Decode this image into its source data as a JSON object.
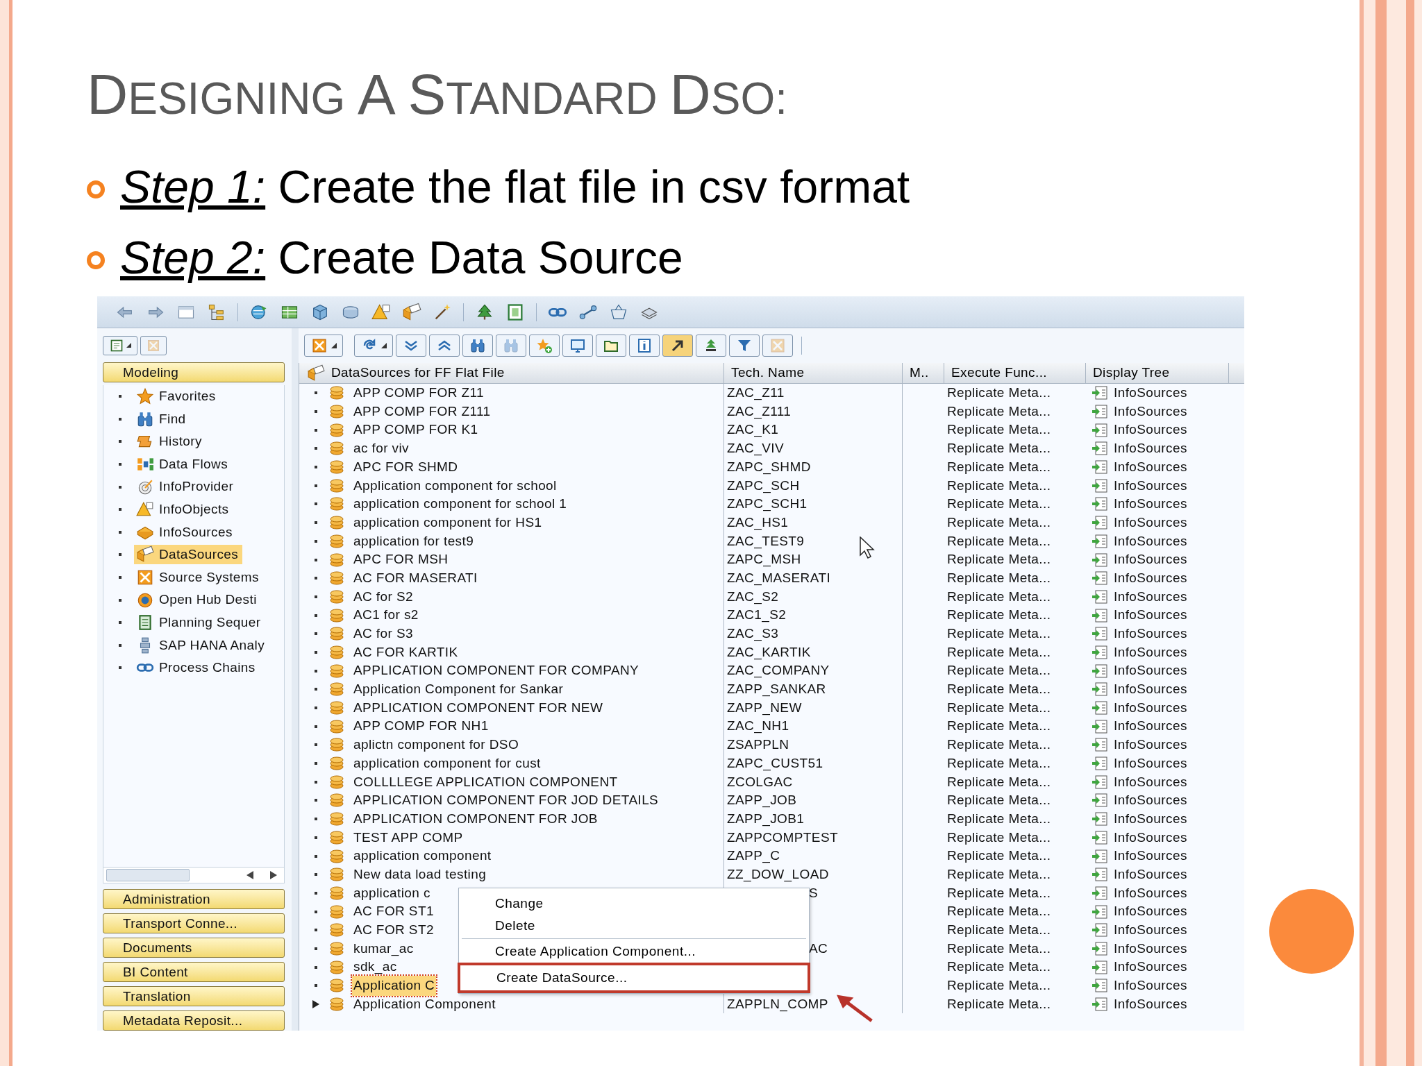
{
  "slide": {
    "title": "DESIGNING A STANDARD DSO:",
    "bullets": [
      {
        "step": "Step 1:",
        "text": "Create the flat file in csv format"
      },
      {
        "step": "Step 2:",
        "text": "Create Data Source"
      }
    ]
  },
  "sidebar": {
    "header": "Modeling",
    "items": [
      {
        "label": "Favorites",
        "selected": false
      },
      {
        "label": "Find",
        "selected": false
      },
      {
        "label": "History",
        "selected": false
      },
      {
        "label": "Data Flows",
        "selected": false
      },
      {
        "label": "InfoProvider",
        "selected": false
      },
      {
        "label": "InfoObjects",
        "selected": false
      },
      {
        "label": "InfoSources",
        "selected": false
      },
      {
        "label": "DataSources",
        "selected": true
      },
      {
        "label": "Source Systems",
        "selected": false
      },
      {
        "label": "Open Hub Desti",
        "selected": false
      },
      {
        "label": "Planning Sequer",
        "selected": false
      },
      {
        "label": "SAP HANA Analy",
        "selected": false
      },
      {
        "label": "Process Chains",
        "selected": false
      }
    ],
    "sections": [
      "Administration",
      "Transport Conne...",
      "Documents",
      "BI Content",
      "Translation",
      "Metadata Reposit..."
    ]
  },
  "table": {
    "columns": [
      "DataSources for FF Flat File",
      "Tech. Name",
      "M..",
      "Execute Func...",
      "Display Tree"
    ],
    "rows": [
      {
        "name": "APP COMP FOR Z11",
        "tech_name": "ZAC_Z11",
        "execute": "Replicate Meta...",
        "display": "InfoSources",
        "expandable": false,
        "selected": false
      },
      {
        "name": "APP COMP FOR Z111",
        "tech_name": "ZAC_Z111",
        "execute": "Replicate Meta...",
        "display": "InfoSources",
        "expandable": false,
        "selected": false
      },
      {
        "name": "APP COMP FOR K1",
        "tech_name": "ZAC_K1",
        "execute": "Replicate Meta...",
        "display": "InfoSources",
        "expandable": false,
        "selected": false
      },
      {
        "name": "ac for viv",
        "tech_name": "ZAC_VIV",
        "execute": "Replicate Meta...",
        "display": "InfoSources",
        "expandable": false,
        "selected": false
      },
      {
        "name": "APC FOR SHMD",
        "tech_name": "ZAPC_SHMD",
        "execute": "Replicate Meta...",
        "display": "InfoSources",
        "expandable": false,
        "selected": false
      },
      {
        "name": "Application component for school",
        "tech_name": "ZAPC_SCH",
        "execute": "Replicate Meta...",
        "display": "InfoSources",
        "expandable": false,
        "selected": false
      },
      {
        "name": "application component for school 1",
        "tech_name": "ZAPC_SCH1",
        "execute": "Replicate Meta...",
        "display": "InfoSources",
        "expandable": false,
        "selected": false
      },
      {
        "name": "application component for HS1",
        "tech_name": "ZAC_HS1",
        "execute": "Replicate Meta...",
        "display": "InfoSources",
        "expandable": false,
        "selected": false
      },
      {
        "name": "application for test9",
        "tech_name": "ZAC_TEST9",
        "execute": "Replicate Meta...",
        "display": "InfoSources",
        "expandable": false,
        "selected": false
      },
      {
        "name": "APC FOR MSH",
        "tech_name": "ZAPC_MSH",
        "execute": "Replicate Meta...",
        "display": "InfoSources",
        "expandable": false,
        "selected": false
      },
      {
        "name": "AC FOR MASERATI",
        "tech_name": "ZAC_MASERATI",
        "execute": "Replicate Meta...",
        "display": "InfoSources",
        "expandable": false,
        "selected": false
      },
      {
        "name": "AC for S2",
        "tech_name": "ZAC_S2",
        "execute": "Replicate Meta...",
        "display": "InfoSources",
        "expandable": false,
        "selected": false
      },
      {
        "name": "AC1 for s2",
        "tech_name": "ZAC1_S2",
        "execute": "Replicate Meta...",
        "display": "InfoSources",
        "expandable": false,
        "selected": false
      },
      {
        "name": "AC for S3",
        "tech_name": "ZAC_S3",
        "execute": "Replicate Meta...",
        "display": "InfoSources",
        "expandable": false,
        "selected": false
      },
      {
        "name": "AC FOR KARTIK",
        "tech_name": "ZAC_KARTIK",
        "execute": "Replicate Meta...",
        "display": "InfoSources",
        "expandable": false,
        "selected": false
      },
      {
        "name": "APPLICATION COMPONENT FOR COMPANY",
        "tech_name": "ZAC_COMPANY",
        "execute": "Replicate Meta...",
        "display": "InfoSources",
        "expandable": false,
        "selected": false
      },
      {
        "name": "Application Component for Sankar",
        "tech_name": "ZAPP_SANKAR",
        "execute": "Replicate Meta...",
        "display": "InfoSources",
        "expandable": false,
        "selected": false
      },
      {
        "name": "APPLICATION COMPONENT FOR NEW",
        "tech_name": "ZAPP_NEW",
        "execute": "Replicate Meta...",
        "display": "InfoSources",
        "expandable": false,
        "selected": false
      },
      {
        "name": "APP COMP FOR NH1",
        "tech_name": "ZAC_NH1",
        "execute": "Replicate Meta...",
        "display": "InfoSources",
        "expandable": false,
        "selected": false
      },
      {
        "name": "aplictn component for DSO",
        "tech_name": "ZSAPPLN",
        "execute": "Replicate Meta...",
        "display": "InfoSources",
        "expandable": false,
        "selected": false
      },
      {
        "name": "application component for cust",
        "tech_name": "ZAPC_CUST51",
        "execute": "Replicate Meta...",
        "display": "InfoSources",
        "expandable": false,
        "selected": false
      },
      {
        "name": "COLLLLEGE APPLICATION COMPONENT",
        "tech_name": "ZCOLGAC",
        "execute": "Replicate Meta...",
        "display": "InfoSources",
        "expandable": false,
        "selected": false
      },
      {
        "name": "APPLICATION COMPONENT FOR JOD DETAILS",
        "tech_name": "ZAPP_JOB",
        "execute": "Replicate Meta...",
        "display": "InfoSources",
        "expandable": false,
        "selected": false
      },
      {
        "name": "APPLICATION COMPONENT FOR JOB",
        "tech_name": "ZAPP_JOB1",
        "execute": "Replicate Meta...",
        "display": "InfoSources",
        "expandable": false,
        "selected": false
      },
      {
        "name": "TEST APP COMP",
        "tech_name": "ZAPPCOMPTEST",
        "execute": "Replicate Meta...",
        "display": "InfoSources",
        "expandable": false,
        "selected": false
      },
      {
        "name": "application component",
        "tech_name": "ZAPP_C",
        "execute": "Replicate Meta...",
        "display": "InfoSources",
        "expandable": false,
        "selected": false
      },
      {
        "name": "New data load testing",
        "tech_name": "ZZ_DOW_LOAD",
        "execute": "Replicate Meta...",
        "display": "InfoSources",
        "expandable": false,
        "selected": false
      },
      {
        "name": "application c",
        "tech_name": "S",
        "tech_name_clipped": true,
        "execute": "Replicate Meta...",
        "display": "InfoSources",
        "expandable": false,
        "selected": false
      },
      {
        "name": "AC FOR ST1",
        "execute": "Replicate Meta...",
        "display": "InfoSources",
        "expandable": false,
        "selected": false
      },
      {
        "name": "AC FOR ST2",
        "execute": "Replicate Meta...",
        "display": "InfoSources",
        "expandable": false,
        "selected": false
      },
      {
        "name": "kumar_ac",
        "tech_name": "AC",
        "tech_name_clipped": true,
        "execute": "Replicate Meta...",
        "display": "InfoSources",
        "expandable": false,
        "selected": false
      },
      {
        "name": "sdk_ac",
        "execute": "Replicate Meta...",
        "display": "InfoSources",
        "expandable": false,
        "selected": false
      },
      {
        "name": "Application C",
        "execute": "Replicate Meta...",
        "display": "InfoSources",
        "expandable": false,
        "selected": true
      },
      {
        "name": "Application Component",
        "tech_name": "ZAPPLN_COMP",
        "execute": "Replicate Meta...",
        "display": "InfoSources",
        "expandable": true,
        "selected": false
      }
    ]
  },
  "context_menu": {
    "items": [
      {
        "kind": "item",
        "label": "Change",
        "highlighted": false
      },
      {
        "kind": "item",
        "label": "Delete",
        "highlighted": false
      },
      {
        "kind": "separator"
      },
      {
        "kind": "item",
        "label": "Create Application Component...",
        "highlighted": false
      },
      {
        "kind": "item",
        "label": "Create DataSource...",
        "highlighted": true
      }
    ]
  }
}
